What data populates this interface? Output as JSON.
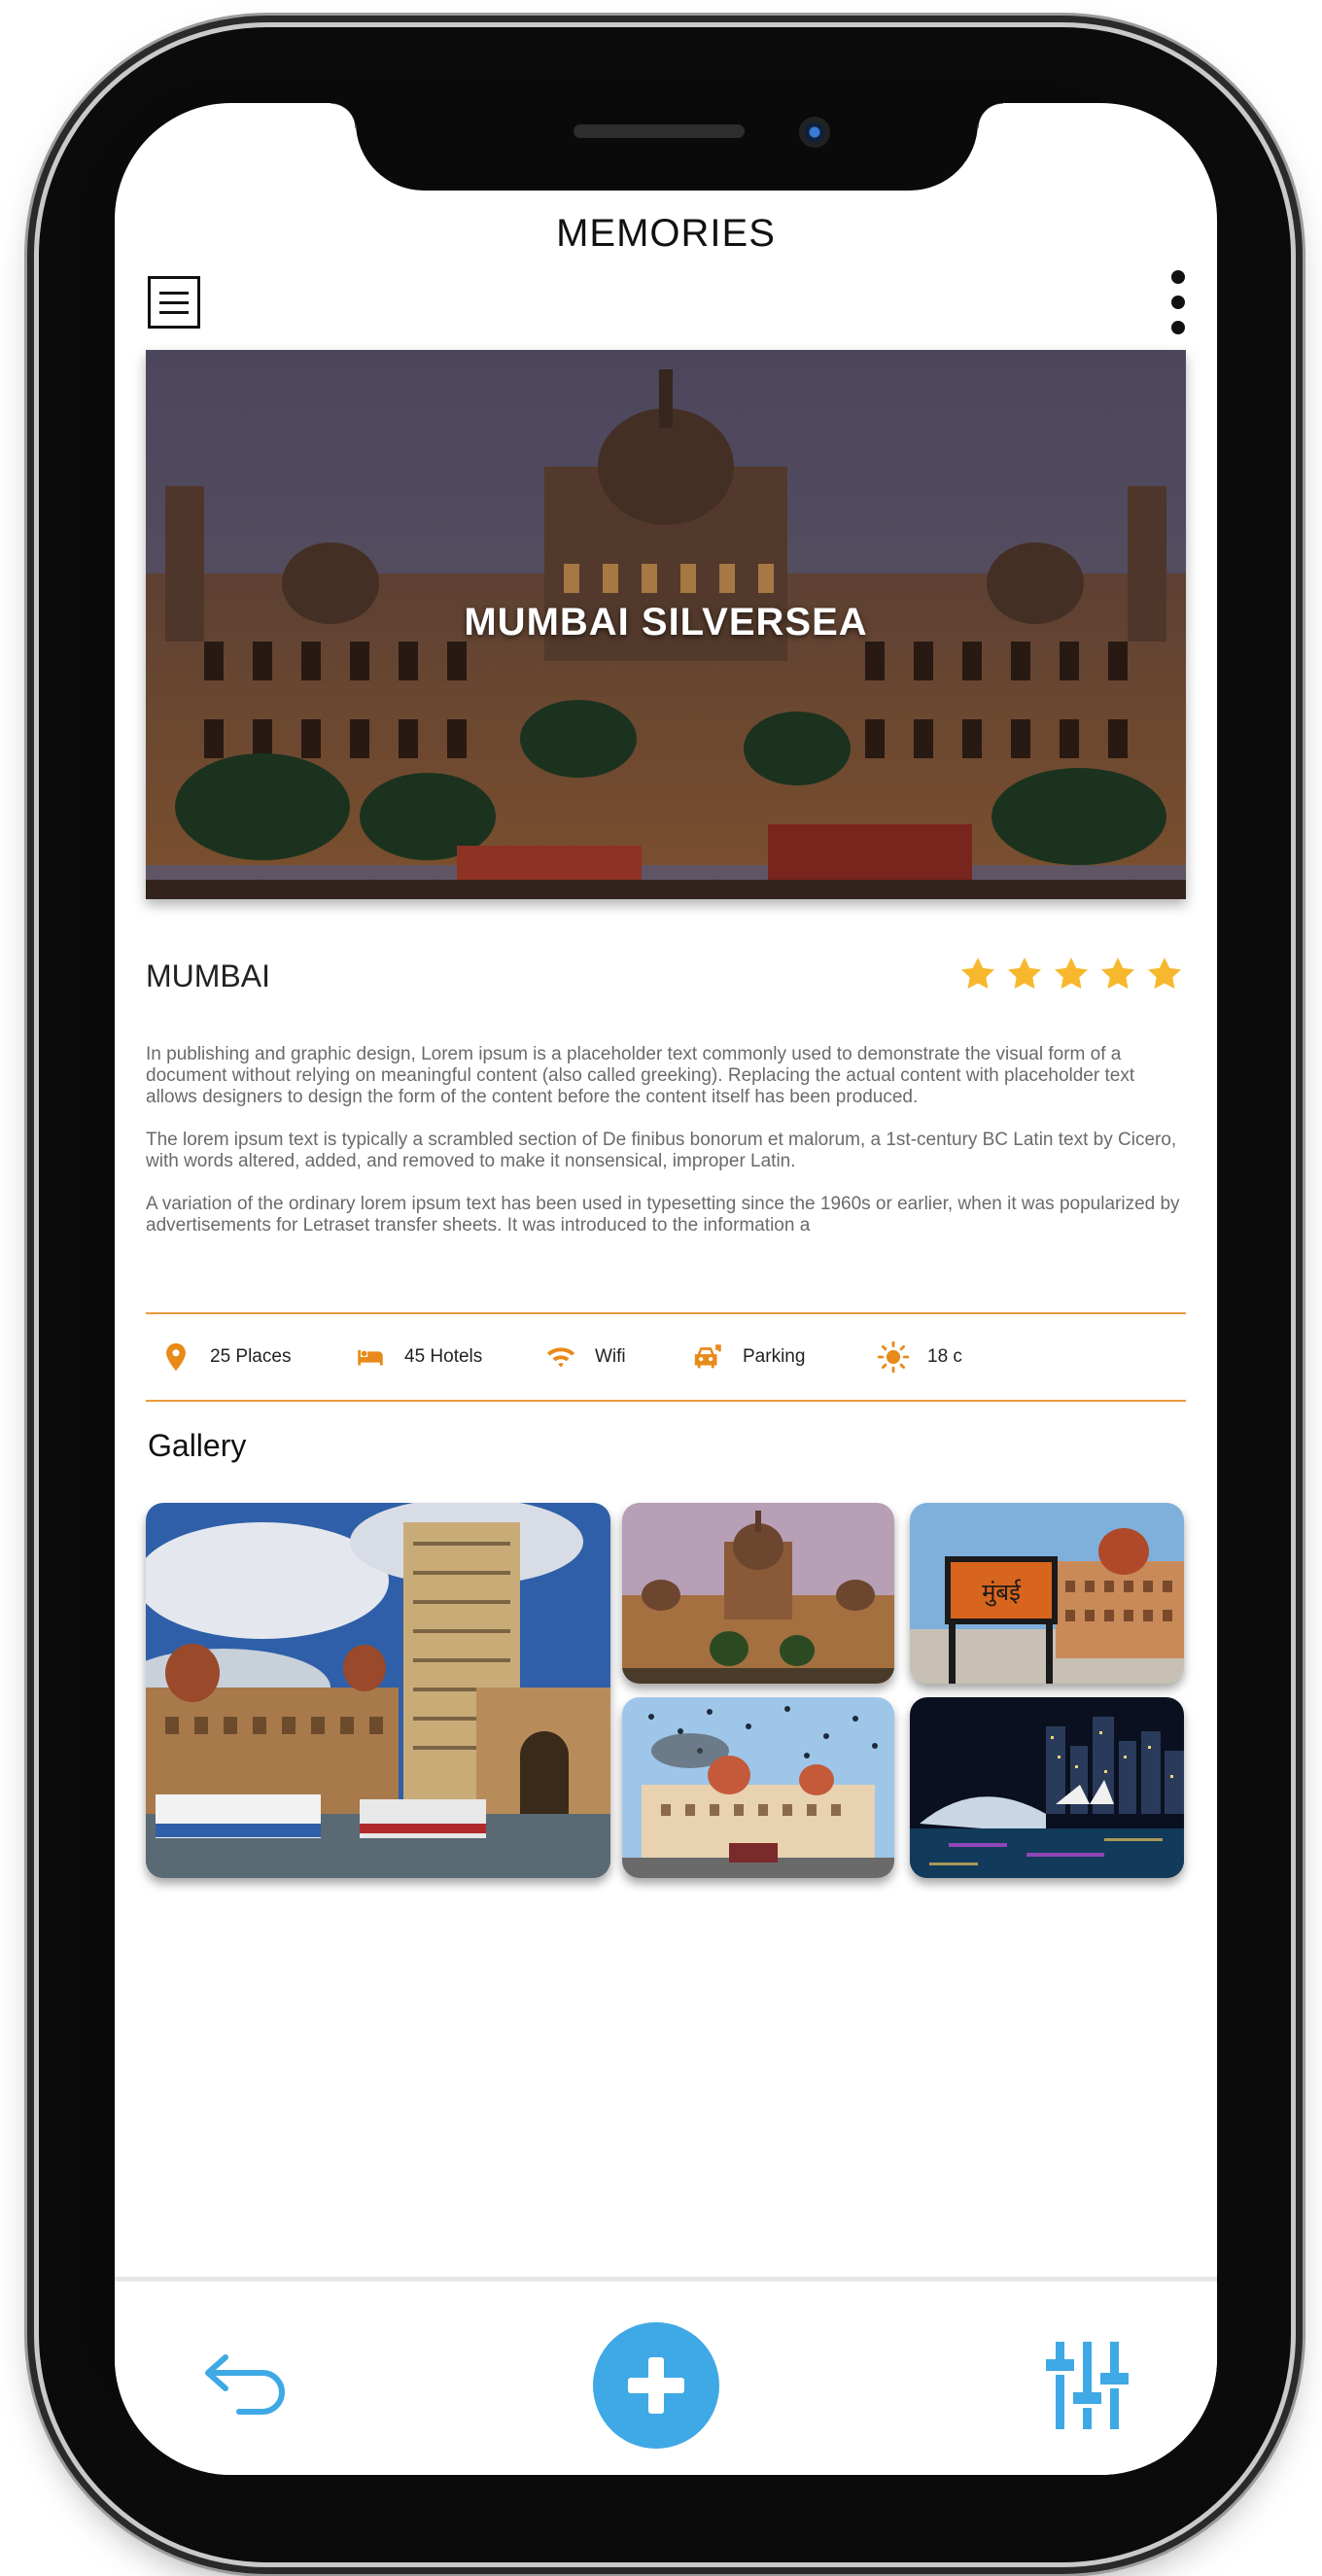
{
  "app": {
    "title": "MEMORIES"
  },
  "hero": {
    "title": "MUMBAI SILVERSEA"
  },
  "city": {
    "name": "MUMBAI",
    "rating": 5,
    "rating_max": 5
  },
  "description": [
    "In publishing and graphic design, Lorem ipsum is a placeholder text commonly used to demonstrate the visual form of a document without relying on meaningful content (also called greeking). Replacing the actual content with placeholder text allows designers to design the form of the content before the content itself has been produced.",
    "The lorem ipsum text is typically a scrambled section of De finibus bonorum et malorum, a 1st-century BC Latin text by Cicero, with words altered, added, and removed to make it nonsensical, improper Latin.",
    "A variation of the ordinary lorem ipsum text has been used in typesetting since the 1960s or earlier, when it was popularized by advertisements for Letraset transfer sheets. It was introduced to the information a"
  ],
  "amenities": [
    {
      "label": "25 Places",
      "icon": "location-pin-icon"
    },
    {
      "label": "45 Hotels",
      "icon": "bed-icon"
    },
    {
      "label": "Wifi",
      "icon": "wifi-icon"
    },
    {
      "label": "Parking",
      "icon": "car-icon"
    },
    {
      "label": "18 c",
      "icon": "sun-icon"
    }
  ],
  "gallery": {
    "title": "Gallery",
    "sign_text": "मुंबई"
  },
  "colors": {
    "accent_orange": "#e88a1a",
    "accent_blue": "#3fa9e5",
    "star": "#f7b82e",
    "divider": "#e89a3c"
  },
  "bottom_nav": [
    {
      "icon": "back-arrow-icon"
    },
    {
      "icon": "plus-icon"
    },
    {
      "icon": "sliders-icon"
    }
  ]
}
